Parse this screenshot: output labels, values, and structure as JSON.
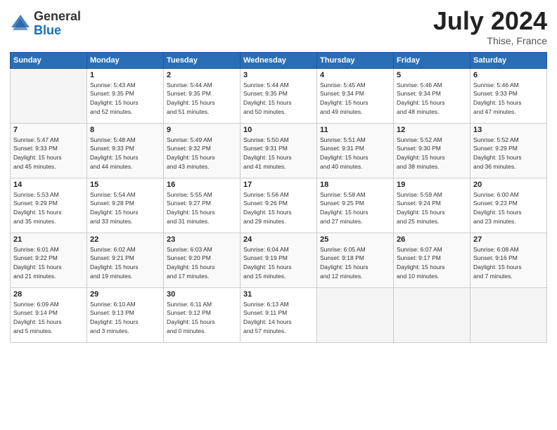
{
  "header": {
    "logo_general": "General",
    "logo_blue": "Blue",
    "title": "July 2024",
    "location": "Thise, France"
  },
  "days_header": [
    "Sunday",
    "Monday",
    "Tuesday",
    "Wednesday",
    "Thursday",
    "Friday",
    "Saturday"
  ],
  "weeks": [
    [
      {
        "day": "",
        "info": ""
      },
      {
        "day": "1",
        "info": "Sunrise: 5:43 AM\nSunset: 9:35 PM\nDaylight: 15 hours\nand 52 minutes."
      },
      {
        "day": "2",
        "info": "Sunrise: 5:44 AM\nSunset: 9:35 PM\nDaylight: 15 hours\nand 51 minutes."
      },
      {
        "day": "3",
        "info": "Sunrise: 5:44 AM\nSunset: 9:35 PM\nDaylight: 15 hours\nand 50 minutes."
      },
      {
        "day": "4",
        "info": "Sunrise: 5:45 AM\nSunset: 9:34 PM\nDaylight: 15 hours\nand 49 minutes."
      },
      {
        "day": "5",
        "info": "Sunrise: 5:46 AM\nSunset: 9:34 PM\nDaylight: 15 hours\nand 48 minutes."
      },
      {
        "day": "6",
        "info": "Sunrise: 5:46 AM\nSunset: 9:33 PM\nDaylight: 15 hours\nand 47 minutes."
      }
    ],
    [
      {
        "day": "7",
        "info": "Sunrise: 5:47 AM\nSunset: 9:33 PM\nDaylight: 15 hours\nand 45 minutes."
      },
      {
        "day": "8",
        "info": "Sunrise: 5:48 AM\nSunset: 9:33 PM\nDaylight: 15 hours\nand 44 minutes."
      },
      {
        "day": "9",
        "info": "Sunrise: 5:49 AM\nSunset: 9:32 PM\nDaylight: 15 hours\nand 43 minutes."
      },
      {
        "day": "10",
        "info": "Sunrise: 5:50 AM\nSunset: 9:31 PM\nDaylight: 15 hours\nand 41 minutes."
      },
      {
        "day": "11",
        "info": "Sunrise: 5:51 AM\nSunset: 9:31 PM\nDaylight: 15 hours\nand 40 minutes."
      },
      {
        "day": "12",
        "info": "Sunrise: 5:52 AM\nSunset: 9:30 PM\nDaylight: 15 hours\nand 38 minutes."
      },
      {
        "day": "13",
        "info": "Sunrise: 5:52 AM\nSunset: 9:29 PM\nDaylight: 15 hours\nand 36 minutes."
      }
    ],
    [
      {
        "day": "14",
        "info": "Sunrise: 5:53 AM\nSunset: 9:29 PM\nDaylight: 15 hours\nand 35 minutes."
      },
      {
        "day": "15",
        "info": "Sunrise: 5:54 AM\nSunset: 9:28 PM\nDaylight: 15 hours\nand 33 minutes."
      },
      {
        "day": "16",
        "info": "Sunrise: 5:55 AM\nSunset: 9:27 PM\nDaylight: 15 hours\nand 31 minutes."
      },
      {
        "day": "17",
        "info": "Sunrise: 5:56 AM\nSunset: 9:26 PM\nDaylight: 15 hours\nand 29 minutes."
      },
      {
        "day": "18",
        "info": "Sunrise: 5:58 AM\nSunset: 9:25 PM\nDaylight: 15 hours\nand 27 minutes."
      },
      {
        "day": "19",
        "info": "Sunrise: 5:59 AM\nSunset: 9:24 PM\nDaylight: 15 hours\nand 25 minutes."
      },
      {
        "day": "20",
        "info": "Sunrise: 6:00 AM\nSunset: 9:23 PM\nDaylight: 15 hours\nand 23 minutes."
      }
    ],
    [
      {
        "day": "21",
        "info": "Sunrise: 6:01 AM\nSunset: 9:22 PM\nDaylight: 15 hours\nand 21 minutes."
      },
      {
        "day": "22",
        "info": "Sunrise: 6:02 AM\nSunset: 9:21 PM\nDaylight: 15 hours\nand 19 minutes."
      },
      {
        "day": "23",
        "info": "Sunrise: 6:03 AM\nSunset: 9:20 PM\nDaylight: 15 hours\nand 17 minutes."
      },
      {
        "day": "24",
        "info": "Sunrise: 6:04 AM\nSunset: 9:19 PM\nDaylight: 15 hours\nand 15 minutes."
      },
      {
        "day": "25",
        "info": "Sunrise: 6:05 AM\nSunset: 9:18 PM\nDaylight: 15 hours\nand 12 minutes."
      },
      {
        "day": "26",
        "info": "Sunrise: 6:07 AM\nSunset: 9:17 PM\nDaylight: 15 hours\nand 10 minutes."
      },
      {
        "day": "27",
        "info": "Sunrise: 6:08 AM\nSunset: 9:16 PM\nDaylight: 15 hours\nand 7 minutes."
      }
    ],
    [
      {
        "day": "28",
        "info": "Sunrise: 6:09 AM\nSunset: 9:14 PM\nDaylight: 15 hours\nand 5 minutes."
      },
      {
        "day": "29",
        "info": "Sunrise: 6:10 AM\nSunset: 9:13 PM\nDaylight: 15 hours\nand 3 minutes."
      },
      {
        "day": "30",
        "info": "Sunrise: 6:11 AM\nSunset: 9:12 PM\nDaylight: 15 hours\nand 0 minutes."
      },
      {
        "day": "31",
        "info": "Sunrise: 6:13 AM\nSunset: 9:11 PM\nDaylight: 14 hours\nand 57 minutes."
      },
      {
        "day": "",
        "info": ""
      },
      {
        "day": "",
        "info": ""
      },
      {
        "day": "",
        "info": ""
      }
    ]
  ]
}
